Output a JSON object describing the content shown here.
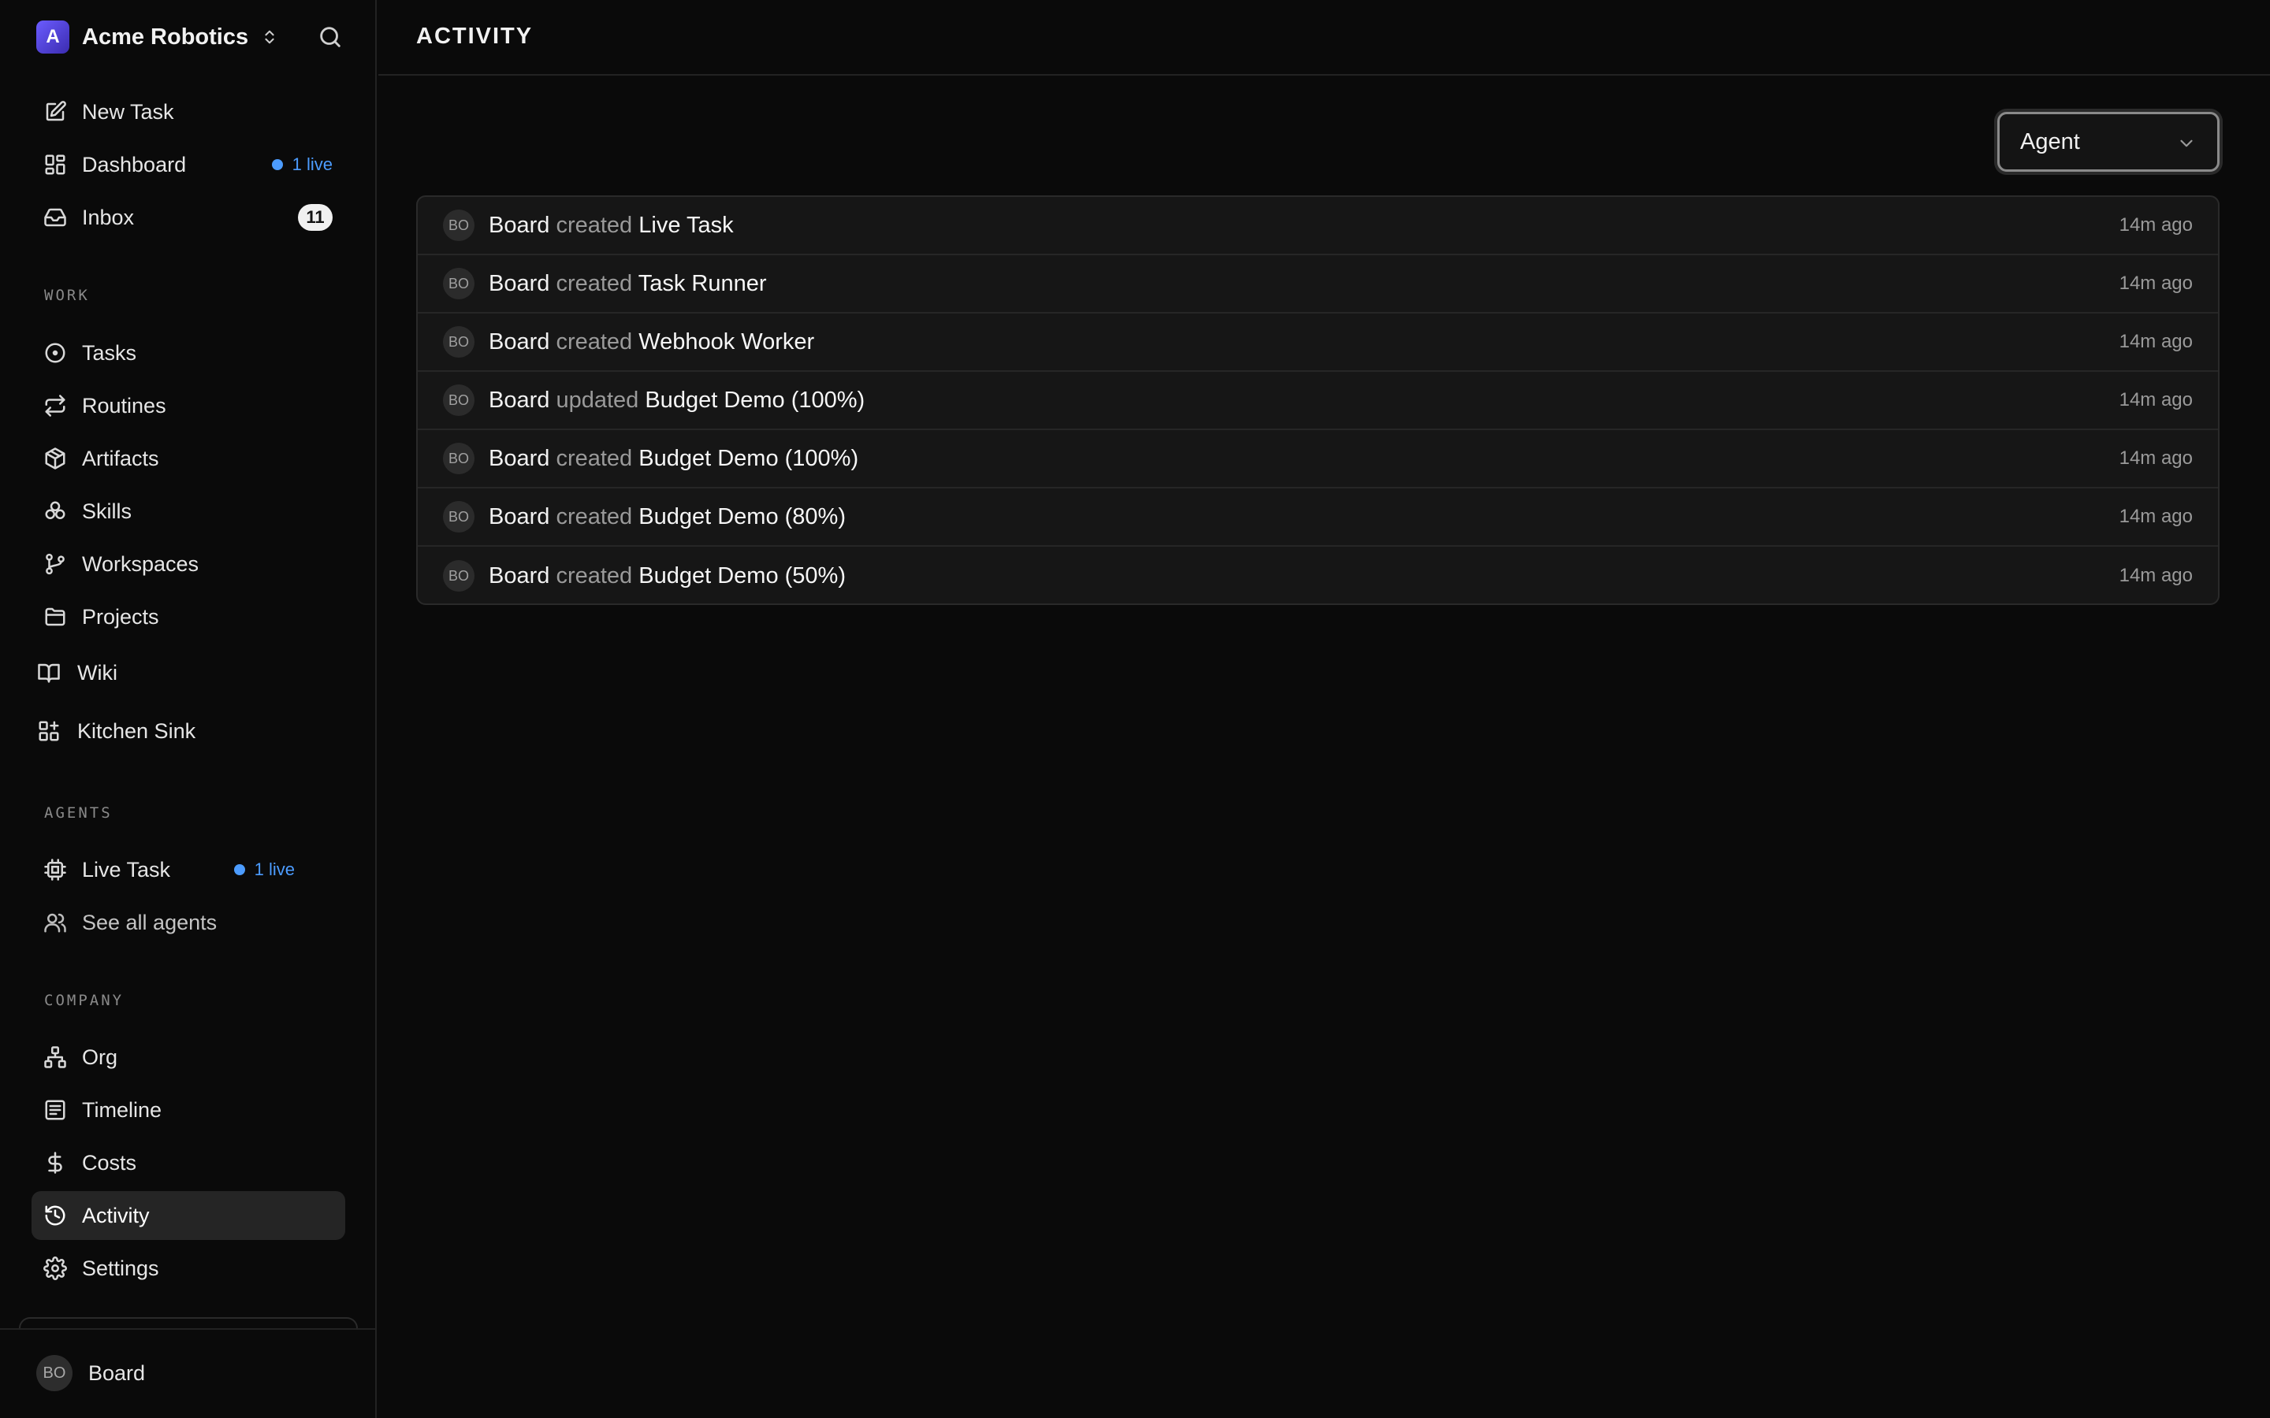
{
  "company": {
    "initial": "A",
    "name": "Acme Robotics"
  },
  "colors": {
    "accent_live": "#4c9cff",
    "brand_logo": "#6b5cff",
    "active_item_bg": "#252525"
  },
  "sidebar": {
    "top_items": [
      {
        "label": "New Task",
        "icon": "pencil-square-icon"
      },
      {
        "label": "Dashboard",
        "icon": "dashboard-icon",
        "badge_live": "1 live"
      },
      {
        "label": "Inbox",
        "icon": "inbox-icon",
        "badge_count": "11"
      }
    ],
    "work_header": "WORK",
    "work_items": [
      {
        "label": "Tasks",
        "icon": "circle-dot-icon"
      },
      {
        "label": "Routines",
        "icon": "repeat-icon"
      },
      {
        "label": "Artifacts",
        "icon": "package-icon"
      },
      {
        "label": "Skills",
        "icon": "skills-icon"
      },
      {
        "label": "Workspaces",
        "icon": "git-branch-icon"
      },
      {
        "label": "Projects",
        "icon": "folder-icon"
      }
    ],
    "extra_items": [
      {
        "label": "Wiki",
        "icon": "book-icon"
      },
      {
        "label": "Kitchen Sink",
        "icon": "grid-plus-icon"
      }
    ],
    "agents_header": "AGENTS",
    "agent_items": [
      {
        "label": "Live Task",
        "icon": "cpu-icon",
        "badge_live": "1 live"
      },
      {
        "label": "See all agents",
        "icon": "users-icon"
      }
    ],
    "company_header": "COMPANY",
    "company_items": [
      {
        "label": "Org",
        "icon": "org-chart-icon"
      },
      {
        "label": "Timeline",
        "icon": "timeline-icon"
      },
      {
        "label": "Costs",
        "icon": "dollar-icon"
      },
      {
        "label": "Activity",
        "icon": "history-icon",
        "active": true
      },
      {
        "label": "Settings",
        "icon": "gear-icon"
      }
    ],
    "user": {
      "initials": "BO",
      "name": "Board"
    }
  },
  "main": {
    "title": "ACTIVITY",
    "filter": {
      "selected": "Agent"
    },
    "activity": [
      {
        "initials": "BO",
        "actor": "Board",
        "verb": "created",
        "target": "Live Task",
        "time": "14m ago"
      },
      {
        "initials": "BO",
        "actor": "Board",
        "verb": "created",
        "target": "Task Runner",
        "time": "14m ago"
      },
      {
        "initials": "BO",
        "actor": "Board",
        "verb": "created",
        "target": "Webhook Worker",
        "time": "14m ago"
      },
      {
        "initials": "BO",
        "actor": "Board",
        "verb": "updated",
        "target": "Budget Demo (100%)",
        "time": "14m ago"
      },
      {
        "initials": "BO",
        "actor": "Board",
        "verb": "created",
        "target": "Budget Demo (100%)",
        "time": "14m ago"
      },
      {
        "initials": "BO",
        "actor": "Board",
        "verb": "created",
        "target": "Budget Demo (80%)",
        "time": "14m ago"
      },
      {
        "initials": "BO",
        "actor": "Board",
        "verb": "created",
        "target": "Budget Demo (50%)",
        "time": "14m ago"
      }
    ]
  }
}
